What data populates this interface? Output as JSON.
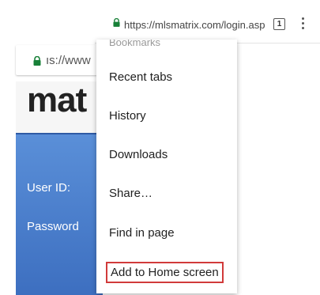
{
  "background_page": {
    "url_fragment": "ıs://www",
    "logo_fragment": "mat",
    "user_label": "User ID:",
    "password_label": "Password"
  },
  "toolbar": {
    "url": "https://mlsmatrix.com/login.asp",
    "tab_count": "1",
    "icons": [
      "lock-icon",
      "overflow-menu-icon"
    ]
  },
  "menu": {
    "cut_item": "Bookmarks",
    "items": [
      "Recent tabs",
      "History",
      "Downloads",
      "Share…",
      "Find in page",
      "Add to Home screen"
    ],
    "highlight_color": "#d13a3a"
  },
  "colors": {
    "lock_green": "#188038",
    "login_blue": "#4a7fd0"
  }
}
